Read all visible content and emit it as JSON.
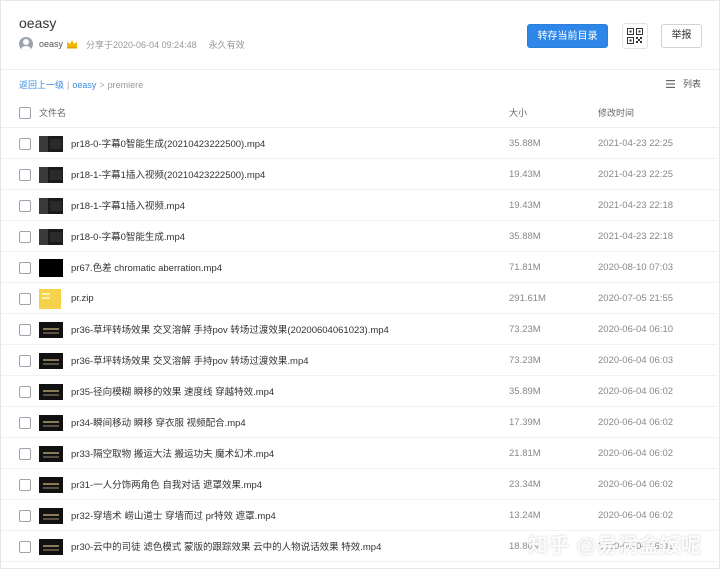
{
  "share": {
    "title": "oeasy",
    "owner": "oeasy",
    "share_time": "分享于2020-06-04 09:24:48",
    "validity": "永久有效"
  },
  "actions": {
    "save_to_dir": "转存当前目录",
    "report": "举报"
  },
  "breadcrumb": {
    "back": "返回上一级",
    "separator": "|",
    "root": "oeasy",
    "arrow": ">",
    "current": "premiere"
  },
  "view": {
    "label": "列表"
  },
  "table": {
    "headers": {
      "name": "文件名",
      "size": "大小",
      "time": "修改时间"
    },
    "rows": [
      {
        "thumb": "video-dark",
        "name": "pr18-0-字幕0智能生成(20210423222500).mp4",
        "size": "35.88M",
        "time": "2021-04-23 22:25"
      },
      {
        "thumb": "video-dark",
        "name": "pr18-1-字幕1插入视频(20210423222500).mp4",
        "size": "19.43M",
        "time": "2021-04-23 22:25"
      },
      {
        "thumb": "video-dark",
        "name": "pr18-1-字幕1插入视频.mp4",
        "size": "19.43M",
        "time": "2021-04-23 22:18"
      },
      {
        "thumb": "video-dark",
        "name": "pr18-0-字幕0智能生成.mp4",
        "size": "35.88M",
        "time": "2021-04-23 22:18"
      },
      {
        "thumb": "video-black",
        "name": "pr67.色差 chromatic aberration.mp4",
        "size": "71.81M",
        "time": "2020-08-10 07:03"
      },
      {
        "thumb": "zip",
        "name": "pr.zip",
        "size": "291.61M",
        "time": "2020-07-05 21:55"
      },
      {
        "thumb": "video-title",
        "name": "pr36-草坪转场效果 交叉溶解 手持pov 转场过渡效果(20200604061023).mp4",
        "size": "73.23M",
        "time": "2020-06-04 06:10"
      },
      {
        "thumb": "video-title",
        "name": "pr36-草坪转场效果 交叉溶解 手持pov 转场过渡效果.mp4",
        "size": "73.23M",
        "time": "2020-06-04 06:03"
      },
      {
        "thumb": "video-title",
        "name": "pr35-径向模糊 瞬移的效果 速度线 穿越特效.mp4",
        "size": "35.89M",
        "time": "2020-06-04 06:02"
      },
      {
        "thumb": "video-title",
        "name": "pr34-瞬间移动 瞬移 穿衣服 视频配合.mp4",
        "size": "17.39M",
        "time": "2020-06-04 06:02"
      },
      {
        "thumb": "video-title",
        "name": "pr33-隔空取物 搬运大法 搬运功夫 魔术幻术.mp4",
        "size": "21.81M",
        "time": "2020-06-04 06:02"
      },
      {
        "thumb": "video-title",
        "name": "pr31-一人分饰两角色 自我对话 遮罩效果.mp4",
        "size": "23.34M",
        "time": "2020-06-04 06:02"
      },
      {
        "thumb": "video-title",
        "name": "pr32-穿墙术 崂山道士 穿墙而过 pr特效 遮罩.mp4",
        "size": "13.24M",
        "time": "2020-06-04 06:02"
      },
      {
        "thumb": "video-title",
        "name": "pr30-云中的司徒 滤色模式 蒙版的跟踪效果 云中的人物说话效果 特效.mp4",
        "size": "18.80M",
        "time": "2020-06-04 06:02"
      }
    ]
  },
  "watermark": "知乎 @易涡盒饭呢",
  "colors": {
    "primary": "#2e87e8",
    "link": "#3b8cdb"
  }
}
